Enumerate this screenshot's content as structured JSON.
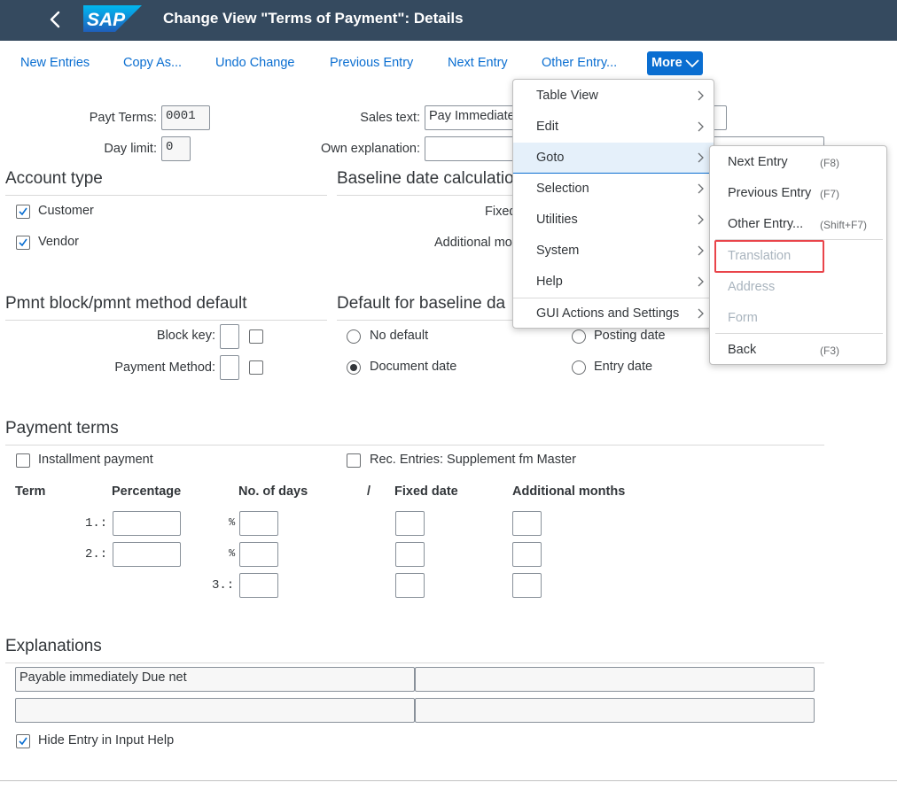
{
  "shell": {
    "title": "Change View \"Terms of Payment\": Details",
    "logo_text": "SAP",
    "bar_color": "#354a5f"
  },
  "toolbar": {
    "new_entries": "New Entries",
    "copy_as": "Copy As...",
    "undo_change": "Undo Change",
    "previous_entry": "Previous Entry",
    "next_entry": "Next Entry",
    "other_entry": "Other Entry...",
    "more": "More",
    "accent": "#0a6ed1"
  },
  "header_fields": {
    "payt_terms_label": "Payt Terms:",
    "payt_terms_value": "0001",
    "day_limit_label": "Day limit:",
    "day_limit_value": "0",
    "sales_text_label": "Sales text:",
    "sales_text_value": "Pay Immediate",
    "own_explanation_label": "Own explanation:"
  },
  "account_type": {
    "title": "Account type",
    "customer": "Customer",
    "vendor": "Vendor"
  },
  "baseline_calc": {
    "title": "Baseline date calculatio",
    "fixed_label": "Fixed",
    "additional_label": "Additional mo"
  },
  "pmnt_block": {
    "title": "Pmnt block/pmnt method default",
    "block_key_label": "Block key:",
    "payment_method_label": "Payment Method:"
  },
  "default_baseline": {
    "title": "Default for baseline da",
    "no_default": "No default",
    "document_date": "Document date",
    "posting_date": "Posting date",
    "entry_date": "Entry date"
  },
  "payment_terms": {
    "title": "Payment terms",
    "installment": "Installment payment",
    "rec_entries": "Rec. Entries: Supplement fm Master",
    "columns": {
      "term": "Term",
      "percentage": "Percentage",
      "days": "No. of days",
      "slash": "/",
      "fixed_date": "Fixed date",
      "add_months": "Additional months"
    },
    "row1": "1.:",
    "row2": "2.:",
    "row3": "3.:",
    "pct": "%"
  },
  "explanations": {
    "title": "Explanations",
    "line1": "Payable immediately Due net",
    "hide_entry": "Hide Entry in Input Help"
  },
  "more_menu": {
    "items": [
      "Table View",
      "Edit",
      "Goto",
      "Selection",
      "Utilities",
      "System",
      "Help",
      "GUI Actions and Settings"
    ],
    "hover_color": "#e5f0fa"
  },
  "goto_submenu": {
    "next_entry": "Next Entry",
    "next_entry_sc": "(F8)",
    "previous_entry": "Previous Entry",
    "previous_entry_sc": "(F7)",
    "other_entry": "Other Entry...",
    "other_entry_sc": "(Shift+F7)",
    "translation": "Translation",
    "address": "Address",
    "form": "Form",
    "back": "Back",
    "back_sc": "(F3)",
    "highlight_color": "#e9444a"
  }
}
